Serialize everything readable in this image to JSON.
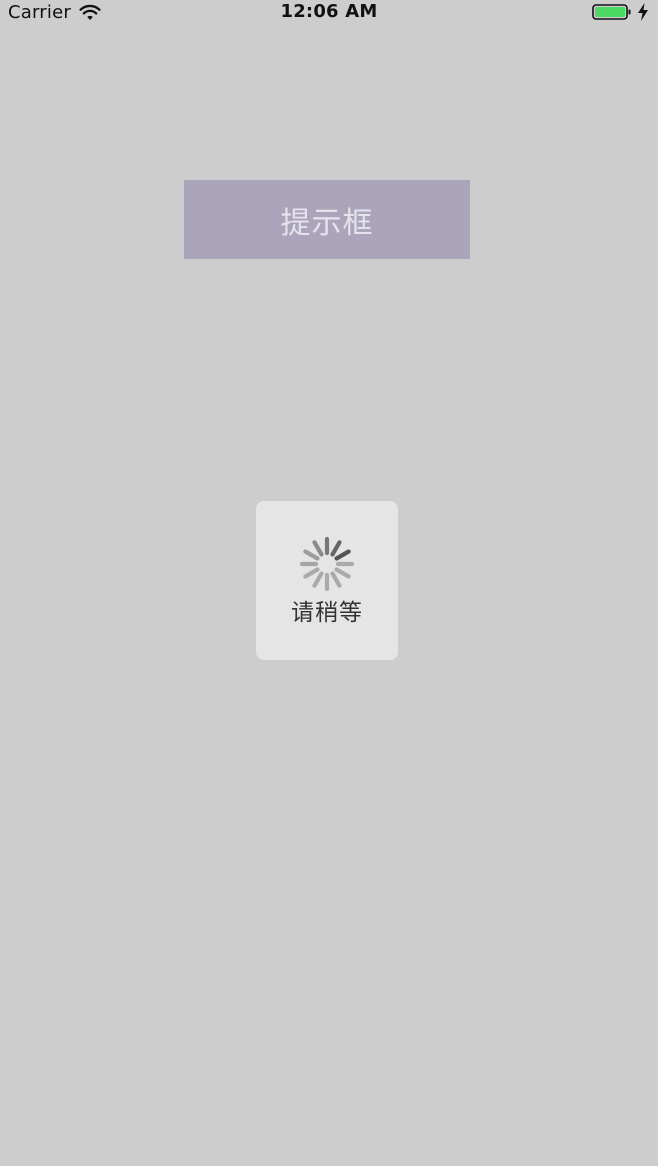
{
  "status_bar": {
    "carrier": "Carrier",
    "time": "12:06 AM",
    "icons": {
      "wifi": "wifi-icon",
      "battery": "battery-icon",
      "charging": "charging-bolt-icon"
    },
    "battery_color": "#4cd964"
  },
  "main": {
    "button_label": "提示框",
    "button_color": "#aaa5ba"
  },
  "hud": {
    "icon": "activity-spinner-icon",
    "label": "请稍等"
  }
}
